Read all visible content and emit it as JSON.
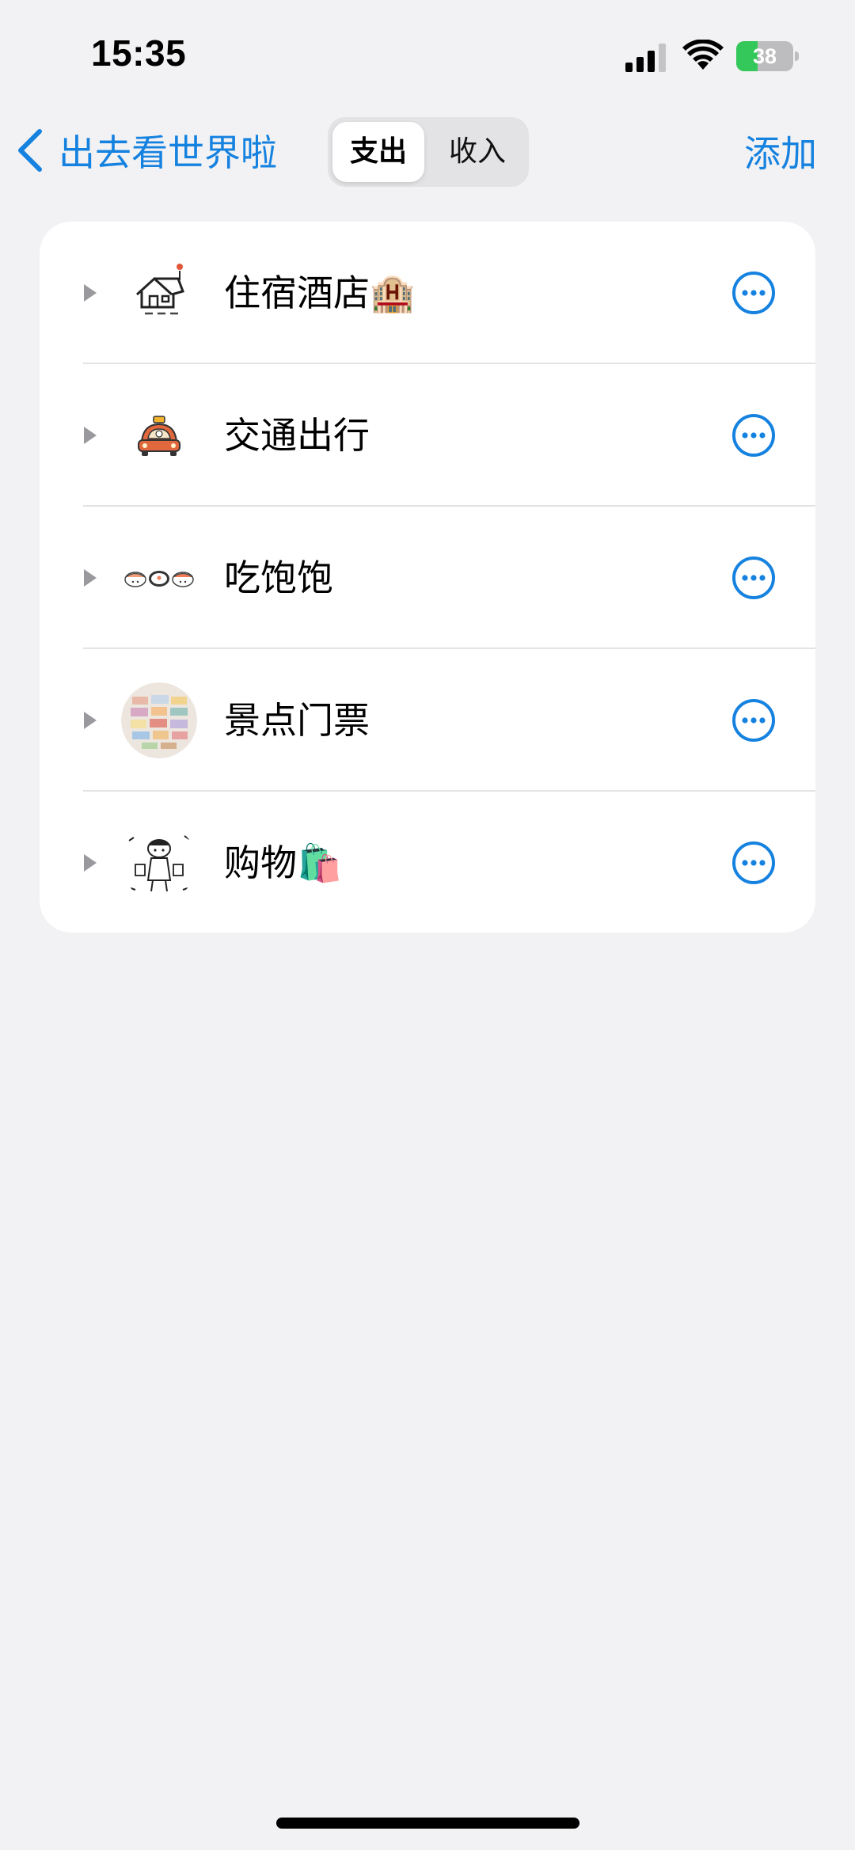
{
  "status_bar": {
    "time": "15:35",
    "battery_level": "38",
    "battery_fraction": 0.38
  },
  "nav": {
    "back_label": "出去看世界啦",
    "segments": [
      {
        "label": "支出",
        "selected": true
      },
      {
        "label": "收入",
        "selected": false
      }
    ],
    "add_label": "添加"
  },
  "categories": [
    {
      "label": "住宿酒店🏨",
      "icon": "house-sketch-icon"
    },
    {
      "label": "交通出行",
      "icon": "taxi-icon"
    },
    {
      "label": "吃饱饱",
      "icon": "sushi-icon"
    },
    {
      "label": "景点门票",
      "icon": "tickets-icon"
    },
    {
      "label": "购物🛍️",
      "icon": "shopping-girl-icon"
    }
  ],
  "colors": {
    "accent": "#1682e0",
    "background": "#f2f2f4",
    "card": "#ffffff",
    "battery_charging": "#34c759"
  }
}
